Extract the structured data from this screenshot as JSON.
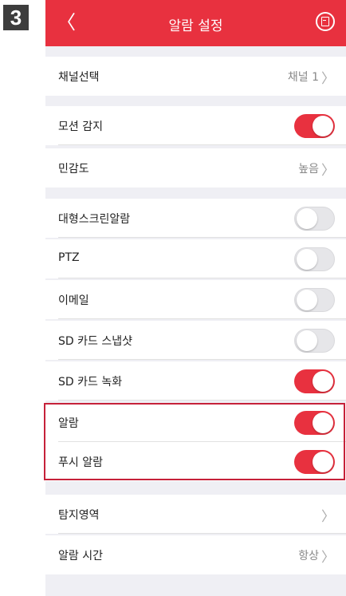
{
  "step_number": "3",
  "header": {
    "title": "알람 설정",
    "back_glyph": "〈"
  },
  "rows": {
    "channel": {
      "label": "채널선택",
      "value": "채널 1"
    },
    "motion": {
      "label": "모션 감지",
      "state": "on"
    },
    "sensitivity": {
      "label": "민감도",
      "value": "높음"
    },
    "big_screen_alarm": {
      "label": "대형스크린알람",
      "state": "off"
    },
    "ptz": {
      "label": "PTZ",
      "state": "off"
    },
    "email": {
      "label": "이메일",
      "state": "off"
    },
    "sd_snapshot": {
      "label": "SD 카드 스냅샷",
      "state": "off"
    },
    "sd_record": {
      "label": "SD 카드 녹화",
      "state": "on"
    },
    "alarm": {
      "label": "알람",
      "state": "on"
    },
    "push_alarm": {
      "label": "푸시 알람",
      "state": "on"
    },
    "detect_area": {
      "label": "탐지영역",
      "value": ""
    },
    "alarm_time": {
      "label": "알람 시간",
      "value": "항상"
    }
  },
  "chevron": "〉",
  "colors": {
    "accent": "#e8313f",
    "highlight_border": "#c6213a",
    "background": "#efeff4"
  },
  "icons": [
    "back-icon",
    "save-icon",
    "chevron-right-icon"
  ]
}
